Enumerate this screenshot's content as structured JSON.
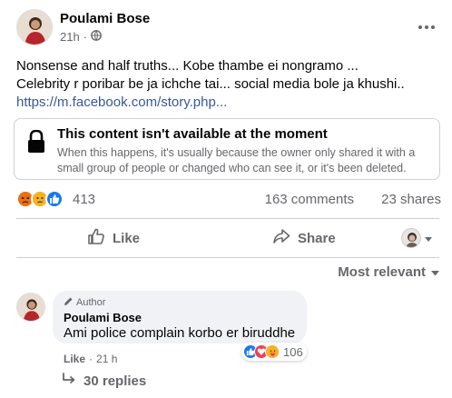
{
  "post": {
    "author": "Poulami Bose",
    "time": "21h",
    "audience_sep": "·",
    "text_line1": "Nonsense and half truths... Kobe thambe ei nongramo ...",
    "text_line2": "Celebrity r poribar be ja ichche tai... social media bole ja khushi..",
    "link": "https://m.facebook.com/story.php..."
  },
  "unavailable": {
    "title": "This content isn't available at the moment",
    "description": "When this happens, it's usually because the owner only shared it with a small group of people or changed who can see it, or it's been deleted."
  },
  "stats": {
    "reactions": "413",
    "comments": "163 comments",
    "shares": "23 shares",
    "reaction_icons": [
      "angry",
      "sad",
      "like"
    ]
  },
  "actions": {
    "like": "Like",
    "share": "Share"
  },
  "sort": {
    "label": "Most relevant"
  },
  "comment": {
    "badge": "Author",
    "author": "Poulami Bose",
    "text": "Ami police complain korbo er biruddhe",
    "reaction_count": "106",
    "reaction_icons": [
      "like",
      "love",
      "care"
    ],
    "like_label": "Like",
    "sep": "·",
    "time": "21 h"
  },
  "replies": {
    "label": "30 replies"
  },
  "colors": {
    "like_blue": "#1877f2",
    "love_red": "#f33e58",
    "angry_orange": "#e9710f",
    "reaction_yellow": "#f7b125",
    "secondary_text": "#65676b",
    "link": "#385898"
  }
}
